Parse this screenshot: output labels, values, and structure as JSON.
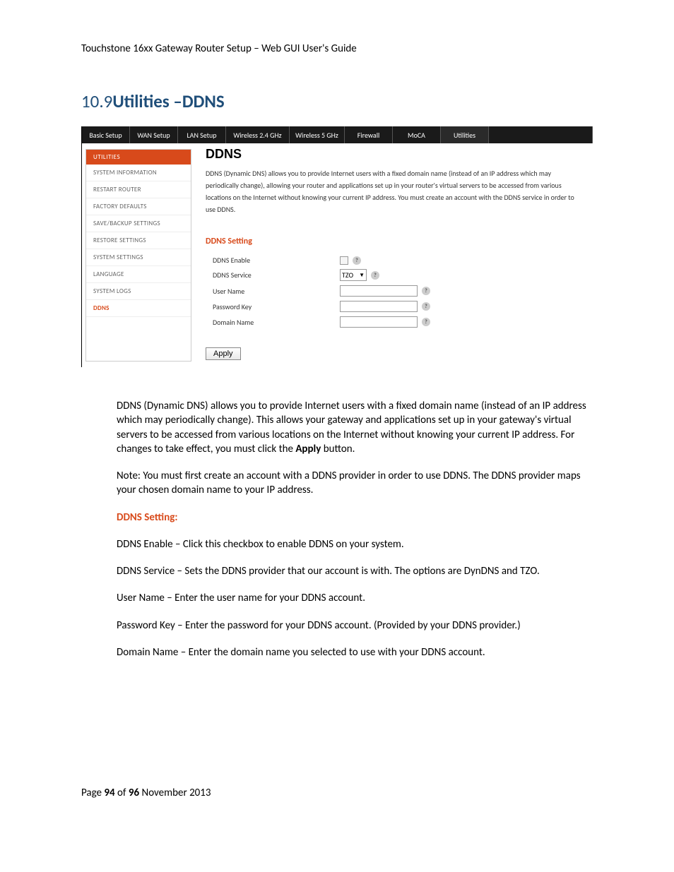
{
  "header": "Touchstone 16xx Gateway Router Setup – Web GUI User's Guide",
  "section": {
    "number": "10.9",
    "title": "Utilities –DDNS"
  },
  "screenshot": {
    "tabs": [
      "Basic Setup",
      "WAN Setup",
      "LAN Setup",
      "Wireless 2.4 GHz",
      "Wireless 5 GHz",
      "Firewall",
      "MoCA",
      "Utilities"
    ],
    "sidebar": {
      "header": "UTILITIES",
      "items": [
        "SYSTEM INFORMATION",
        "RESTART ROUTER",
        "FACTORY DEFAULTS",
        "SAVE/BACKUP SETTINGS",
        "RESTORE SETTINGS",
        "SYSTEM SETTINGS",
        "LANGUAGE",
        "SYSTEM LOGS",
        "DDNS"
      ]
    },
    "panel": {
      "title": "DDNS",
      "desc": "DDNS (Dynamic DNS) allows you to provide Internet users with a fixed domain name (instead of an IP address which may periodically change), allowing your router and applications set up in your router's virtual servers to be accessed from various locations on the Internet without knowing your current IP address. You must create an account with the DDNS service in order to use DDNS.",
      "section_header": "DDNS Setting",
      "rows": {
        "enable": "DDNS Enable",
        "service": "DDNS Service",
        "service_value": "TZO",
        "username": "User Name",
        "password": "Password Key",
        "domain": "Domain Name"
      },
      "apply": "Apply"
    }
  },
  "body": {
    "p1": "DDNS (Dynamic DNS) allows you to provide Internet users with a fixed domain name (instead of an IP address which may periodically change).  This allows your gateway and applications set up in your gateway's virtual servers to be accessed from various locations on the Internet without knowing your current IP address.  For changes to take effect, you must click the ",
    "p1_bold": "Apply",
    "p1_end": " button.",
    "p2": "Note:  You must first create an account with a DDNS provider in order to use DDNS.  The DDNS provider maps your chosen domain name to your IP address.",
    "subheader": "DDNS Setting:",
    "p3": "DDNS Enable – Click this checkbox to enable DDNS on your system.",
    "p4": "DDNS Service – Sets the DDNS provider that our account is with.  The options are DynDNS and TZO.",
    "p5": "User Name – Enter the user name for your DDNS account.",
    "p6": "Password Key – Enter the password for your DDNS account.  (Provided by your DDNS provider.)",
    "p7": "Domain Name – Enter the domain name you selected to use with your DDNS account."
  },
  "footer": {
    "prefix": "Page ",
    "page": "94",
    "of": " of ",
    "total": "96",
    "date": "   November 2013"
  }
}
